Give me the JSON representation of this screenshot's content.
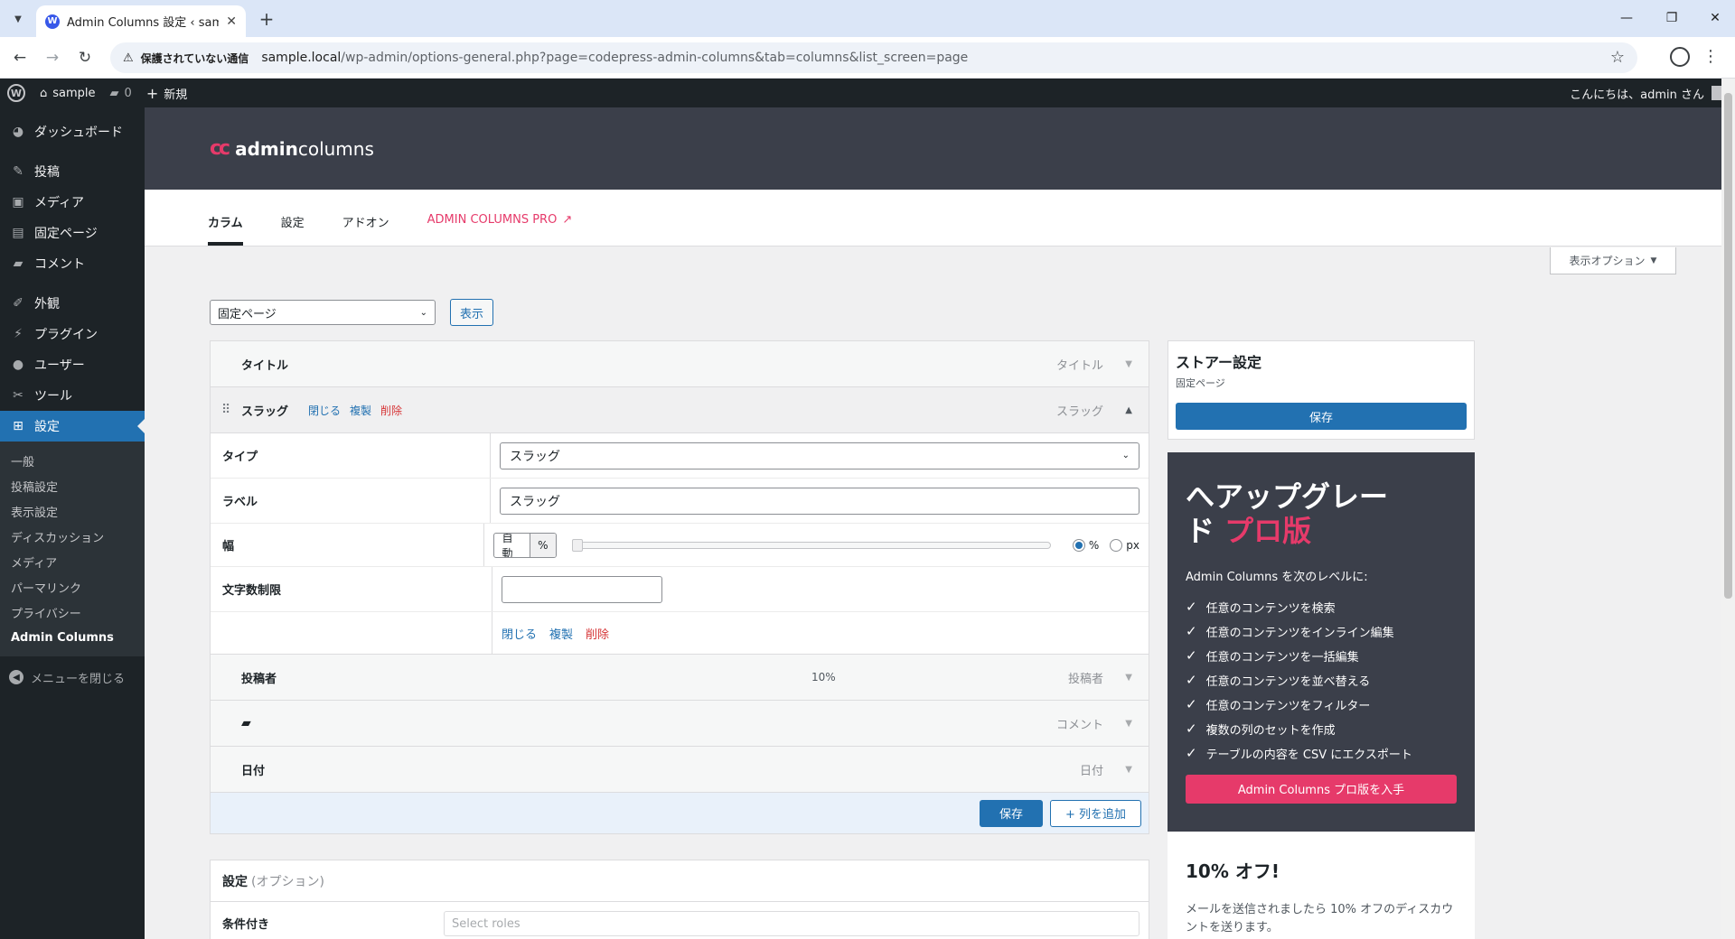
{
  "browser": {
    "tab_title": "Admin Columns 設定 ‹ sample",
    "security_label": "保護されていない通信",
    "url_host": "sample.local",
    "url_path": "/wp-admin/options-general.php?page=codepress-admin-columns&tab=columns&list_screen=page"
  },
  "adminbar": {
    "site_name": "sample",
    "comment_count": "0",
    "new_label": "新規",
    "greeting": "こんにちは、admin さん"
  },
  "menu": {
    "dashboard": "ダッシュボード",
    "posts": "投稿",
    "media": "メディア",
    "pages": "固定ページ",
    "comments": "コメント",
    "appearance": "外観",
    "plugins": "プラグイン",
    "users": "ユーザー",
    "tools": "ツール",
    "settings": "設定",
    "submenu": [
      "一般",
      "投稿設定",
      "表示設定",
      "ディスカッション",
      "メディア",
      "パーマリンク",
      "プライバシー",
      "Admin Columns"
    ],
    "collapse": "メニューを閉じる"
  },
  "ac": {
    "logo_bold": "admin",
    "logo_rest": "columns",
    "tabs": [
      "カラム",
      "設定",
      "アドオン",
      "ADMIN COLUMNS PRO"
    ],
    "screen_options": "表示オプション",
    "list_screen": "固定ページ",
    "show_button": "表示"
  },
  "columns": {
    "title": {
      "label": "タイトル",
      "type": "タイトル"
    },
    "slug": {
      "label": "スラッグ",
      "type": "スラッグ",
      "close": "閉じる",
      "duplicate": "複製",
      "delete": "削除"
    },
    "settings": {
      "type_label": "タイプ",
      "type_value": "スラッグ",
      "label_label": "ラベル",
      "label_value": "スラッグ",
      "width_label": "幅",
      "width_value": "自動",
      "width_unit": "%",
      "unit_percent": "%",
      "unit_px": "px",
      "char_limit_label": "文字数制限",
      "char_limit_value": ""
    },
    "author": {
      "label": "投稿者",
      "width": "10%",
      "type": "投稿者"
    },
    "comments": {
      "type": "コメント"
    },
    "date": {
      "label": "日付",
      "type": "日付"
    },
    "save": "保存",
    "add_column": "+ 列を追加"
  },
  "options": {
    "title": "設定",
    "subtitle": "(オプション)",
    "conditional_label": "条件付き",
    "roles_placeholder": "Select roles"
  },
  "store": {
    "title": "ストアー設定",
    "subtitle": "固定ページ",
    "save": "保存"
  },
  "promo": {
    "title_line1": "へアップグレー",
    "title_line2_a": "ド ",
    "title_line2_pro": "プロ版",
    "intro": "Admin Columns を次のレベルに:",
    "items": [
      "任意のコンテンツを検索",
      "任意のコンテンツをインライン編集",
      "任意のコンテンツを一括編集",
      "任意のコンテンツを並べ替える",
      "任意のコンテンツをフィルター",
      "複数の列のセットを作成",
      "テーブルの内容を CSV にエクスポート"
    ],
    "cta": "Admin Columns プロ版を入手"
  },
  "discount": {
    "title": "10% オフ!",
    "text": "メールを送信されましたら 10% オフのディスカウントを送ります。"
  },
  "colors": {
    "accent": "#2271b1",
    "brand_pink": "#e63a6a",
    "dark": "#1d2327",
    "header": "#3b3f4a"
  }
}
